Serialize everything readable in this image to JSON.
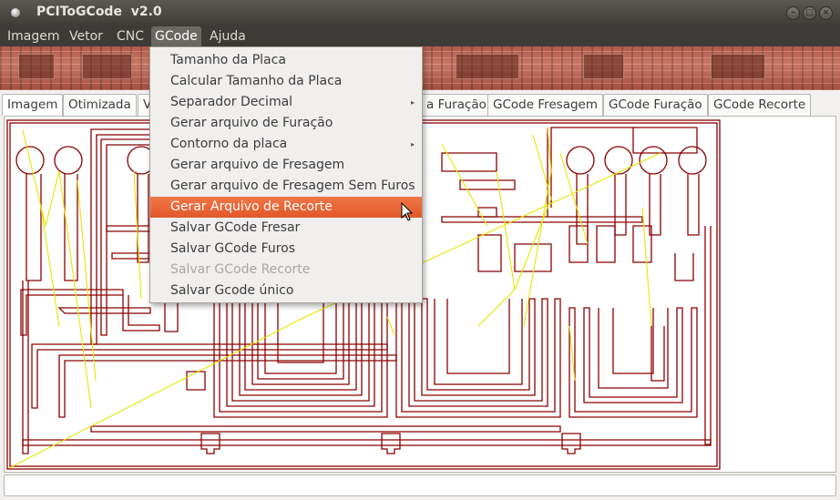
{
  "window": {
    "title": "PCIToGCode  v2.0",
    "controls": {
      "minimize": "–",
      "maximize": "□",
      "close": "×"
    }
  },
  "menubar": {
    "items": [
      "Imagem",
      "Vetor",
      "CNC",
      "GCode",
      "Ajuda"
    ],
    "active": "GCode"
  },
  "tabs": [
    {
      "label": "Imagem"
    },
    {
      "label": "Otimizada"
    },
    {
      "label": "V"
    },
    {
      "label": "a Furação"
    },
    {
      "label": "GCode Fresagem"
    },
    {
      "label": "GCode Furação"
    },
    {
      "label": "GCode Recorte"
    }
  ],
  "gcode_menu": {
    "items": [
      {
        "label": "Tamanho da Placa",
        "state": "normal",
        "submenu": false
      },
      {
        "label": "Calcular Tamanho da Placa",
        "state": "normal",
        "submenu": false
      },
      {
        "label": "Separador Decimal",
        "state": "normal",
        "submenu": true
      },
      {
        "label": "Gerar arquivo de Furação",
        "state": "normal",
        "submenu": false
      },
      {
        "label": "Contorno da placa",
        "state": "normal",
        "submenu": true
      },
      {
        "label": "Gerar arquivo de Fresagem",
        "state": "normal",
        "submenu": false
      },
      {
        "label": "Gerar arquivo de Fresagem Sem Furos",
        "state": "normal",
        "submenu": false
      },
      {
        "label": "Gerar Arquivo de Recorte",
        "state": "highlighted",
        "submenu": false
      },
      {
        "label": "Salvar GCode Fresar",
        "state": "normal",
        "submenu": false
      },
      {
        "label": "Salvar GCode Furos",
        "state": "normal",
        "submenu": false
      },
      {
        "label": "Salvar GCode Recorte",
        "state": "disabled",
        "submenu": false
      },
      {
        "label": "Salvar Gcode único",
        "state": "normal",
        "submenu": false
      }
    ],
    "submenu_arrow": "▸"
  },
  "colors": {
    "trace": "#8b0000",
    "path": "#e6e600",
    "highlight": "#e95420",
    "titlebar": "#3c3b37"
  },
  "icons": {
    "app": "circle-dot-icon",
    "cursor": "mouse-pointer-icon"
  }
}
